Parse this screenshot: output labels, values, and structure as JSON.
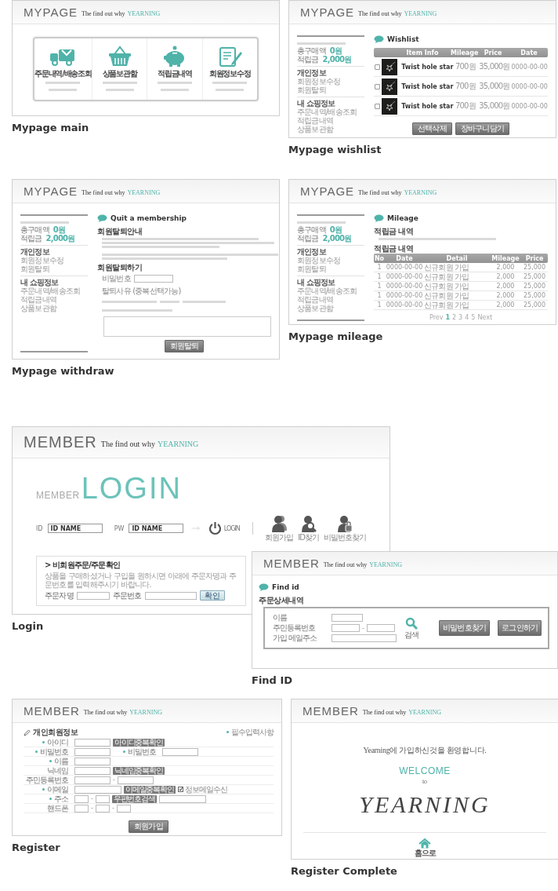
{
  "mypage_main": {
    "header": {
      "title": "MYPAGE",
      "tagline": "The find out why",
      "brand": "YEARNING"
    },
    "tiles": [
      {
        "kind": "truck",
        "title": "주문내역/배송조회"
      },
      {
        "kind": "basket",
        "title": "상품보관함"
      },
      {
        "kind": "piggy",
        "title": "적립금내역"
      },
      {
        "kind": "document",
        "title": "회원정보수정"
      }
    ],
    "caption": "Mypage main"
  },
  "mypage_wishlist": {
    "header": {
      "title": "MYPAGE",
      "tagline": "The find out why",
      "brand": "YEARNING"
    },
    "sidebar": {
      "summary": [
        {
          "label": "총구매액",
          "value": "0원"
        },
        {
          "label": "적립금",
          "value": "2,000원"
        }
      ],
      "groups": [
        {
          "title": "개인정보",
          "links": [
            "회원정보수정",
            "회원탈퇴"
          ]
        },
        {
          "title": "내 쇼핑정보",
          "links": [
            "주문내역/배송조회",
            "적립금내역",
            "상품보관함"
          ]
        }
      ]
    },
    "title": "Wishlist",
    "columns": [
      "Item Info",
      "Mileage",
      "Price",
      "Date"
    ],
    "rows": [
      {
        "checked": false,
        "name": "Twist hole star",
        "mileage": "700원",
        "price": "35,000원",
        "date": "0000-00-00"
      },
      {
        "checked": false,
        "name": "Twist hole star",
        "mileage": "700원",
        "price": "35,000원",
        "date": "0000-00-00"
      },
      {
        "checked": false,
        "name": "Twist hole star",
        "mileage": "700원",
        "price": "35,000원",
        "date": "0000-00-00"
      }
    ],
    "buttons": [
      "선택삭제",
      "장바구니담기"
    ],
    "caption": "Mypage wishlist"
  },
  "mypage_withdraw": {
    "header": {
      "title": "MYPAGE",
      "tagline": "The find out why",
      "brand": "YEARNING"
    },
    "sidebar": {
      "summary": [
        {
          "label": "총구매액",
          "value": "0원"
        },
        {
          "label": "적립금",
          "value": "2,000원"
        }
      ],
      "groups": [
        {
          "title": "개인정보",
          "links": [
            "회원정보수정",
            "회원탈퇴"
          ]
        },
        {
          "title": "내 쇼핑정보",
          "links": [
            "주문내역/배송조회",
            "적립금내역",
            "상품보관함"
          ]
        }
      ]
    },
    "title": "Quit a membership",
    "notice_heading": "회원탈퇴안내",
    "form_heading": "회원탈퇴하기",
    "password_label": "비밀번호",
    "reason_label": "탈퇴사유 (중복선택가능)",
    "button": "회원탈퇴",
    "caption": "Mypage withdraw"
  },
  "mypage_mileage": {
    "header": {
      "title": "MYPAGE",
      "tagline": "The find out why",
      "brand": "YEARNING"
    },
    "sidebar": {
      "summary": [
        {
          "label": "총구매액",
          "value": "0원"
        },
        {
          "label": "적립금",
          "value": "2,000원"
        }
      ],
      "groups": [
        {
          "title": "개인정보",
          "links": [
            "회원정보수정",
            "회원탈퇴"
          ]
        },
        {
          "title": "내 쇼핑정보",
          "links": [
            "주문내역/배송조회",
            "적립금내역",
            "상품보관함"
          ]
        }
      ]
    },
    "title": "Mileage",
    "summary_heading": "적립금 내역",
    "list_heading": "적립금 내역",
    "columns": [
      "No",
      "Date",
      "Detail",
      "Mileage",
      "Price"
    ],
    "rows": [
      {
        "no": "1",
        "date": "0000-00-00",
        "detail": "신규회원 가입",
        "mileage": "2,000",
        "price": "25,000"
      },
      {
        "no": "1",
        "date": "0000-00-00",
        "detail": "신규회원 가입",
        "mileage": "2,000",
        "price": "25,000"
      },
      {
        "no": "1",
        "date": "0000-00-00",
        "detail": "신규회원 가입",
        "mileage": "2,000",
        "price": "25,000"
      },
      {
        "no": "1",
        "date": "0000-00-00",
        "detail": "신규회원 가입",
        "mileage": "2,000",
        "price": "25,000"
      },
      {
        "no": "1",
        "date": "0000-00-00",
        "detail": "신규회원 가입",
        "mileage": "2,000",
        "price": "25,000"
      }
    ],
    "pagination": {
      "prev": "Prev",
      "pages": [
        {
          "label": "1",
          "selected": true
        },
        {
          "label": "2",
          "selected": false
        },
        {
          "label": "3",
          "selected": false
        },
        {
          "label": "4",
          "selected": false
        },
        {
          "label": "5",
          "selected": false
        }
      ],
      "next": "Next"
    },
    "caption": "Mypage mileage"
  },
  "login": {
    "header": {
      "title": "MEMBER",
      "tagline": "The find out why",
      "brand": "YEARNING"
    },
    "heading_small": "MEMBER",
    "heading_large": "LOGIN",
    "id_label": "ID",
    "id_value": "ID NAME",
    "pw_label": "PW",
    "pw_value": "ID NAME",
    "login_label": "LOGIN",
    "links": [
      {
        "kind": "join",
        "label": "회원가입"
      },
      {
        "kind": "find-id",
        "label": "ID찾기"
      },
      {
        "kind": "find-password",
        "label": "비밀번호찾기"
      }
    ],
    "guest": {
      "title": "> 비회원주문/주문확인",
      "text": "상품을 구매하셨거나 구입을 원하시면 아래에 주문자명과 주문번호를 입력해주시기 바랍니다.",
      "name_label": "주문자명",
      "order_label": "주문번호",
      "button": "확인"
    },
    "caption": "Login"
  },
  "find_id": {
    "header": {
      "title": "MEMBER",
      "tagline": "The find out why",
      "brand": "YEARNING"
    },
    "title": "Find id",
    "subheading": "주문상세내역",
    "fields": [
      {
        "label": "이름",
        "kind": "single"
      },
      {
        "label": "주민등록번호",
        "kind": "split",
        "separator": "-"
      },
      {
        "label": "가입 메일주소",
        "kind": "wide"
      }
    ],
    "search_label": "검색",
    "buttons": [
      "비밀번호찾기",
      "로그인하기"
    ],
    "caption": "Find ID"
  },
  "register": {
    "header": {
      "title": "MEMBER",
      "tagline": "The find out why",
      "brand": "YEARNING"
    },
    "title": "개인회원정보",
    "required_note": "필수입력사항",
    "rows": [
      {
        "label": "아이디",
        "required": true,
        "items": [
          {
            "kind": "field"
          },
          {
            "kind": "button",
            "text": "아이디중복확인"
          }
        ]
      },
      {
        "label": "비밀번호",
        "required": true,
        "items": [
          {
            "kind": "field"
          },
          {
            "kind": "label",
            "text": "비밀번호",
            "required": true
          },
          {
            "kind": "field"
          }
        ]
      },
      {
        "label": "이름",
        "required": true,
        "items": [
          {
            "kind": "field"
          }
        ]
      },
      {
        "label": "닉네임",
        "required": false,
        "items": [
          {
            "kind": "field"
          },
          {
            "kind": "button",
            "text": "닉네임중복확인"
          }
        ]
      },
      {
        "label": "주민등록번호",
        "required": false,
        "items": [
          {
            "kind": "field"
          },
          {
            "kind": "dash",
            "text": "-"
          },
          {
            "kind": "field"
          }
        ]
      },
      {
        "label": "이메일",
        "required": true,
        "items": [
          {
            "kind": "wide-field"
          },
          {
            "kind": "button",
            "text": "이메일중복확인"
          },
          {
            "kind": "checkbox",
            "text": "정보메일수신",
            "checked": true
          }
        ]
      },
      {
        "label": "주소",
        "required": true,
        "items": [
          {
            "kind": "short-field"
          },
          {
            "kind": "dash",
            "text": "-"
          },
          {
            "kind": "short-field"
          },
          {
            "kind": "button",
            "text": "우편번호검색"
          },
          {
            "kind": "wide-field"
          }
        ]
      },
      {
        "label": "핸드폰",
        "required": false,
        "items": [
          {
            "kind": "short-field"
          },
          {
            "kind": "dash",
            "text": "-"
          },
          {
            "kind": "short-field"
          },
          {
            "kind": "dash",
            "text": "-"
          },
          {
            "kind": "short-field"
          }
        ]
      }
    ],
    "button": "회원가입",
    "caption": "Register"
  },
  "register_complete": {
    "header": {
      "title": "MEMBER",
      "tagline": "The find out why",
      "brand": "YEARNING"
    },
    "message": "Yearning에 가입하신것을 환영합니다.",
    "welcome": "WELCOME",
    "to": "to",
    "logo": "YEARNING",
    "home_label": "홈으로",
    "caption": "Register Complete"
  }
}
